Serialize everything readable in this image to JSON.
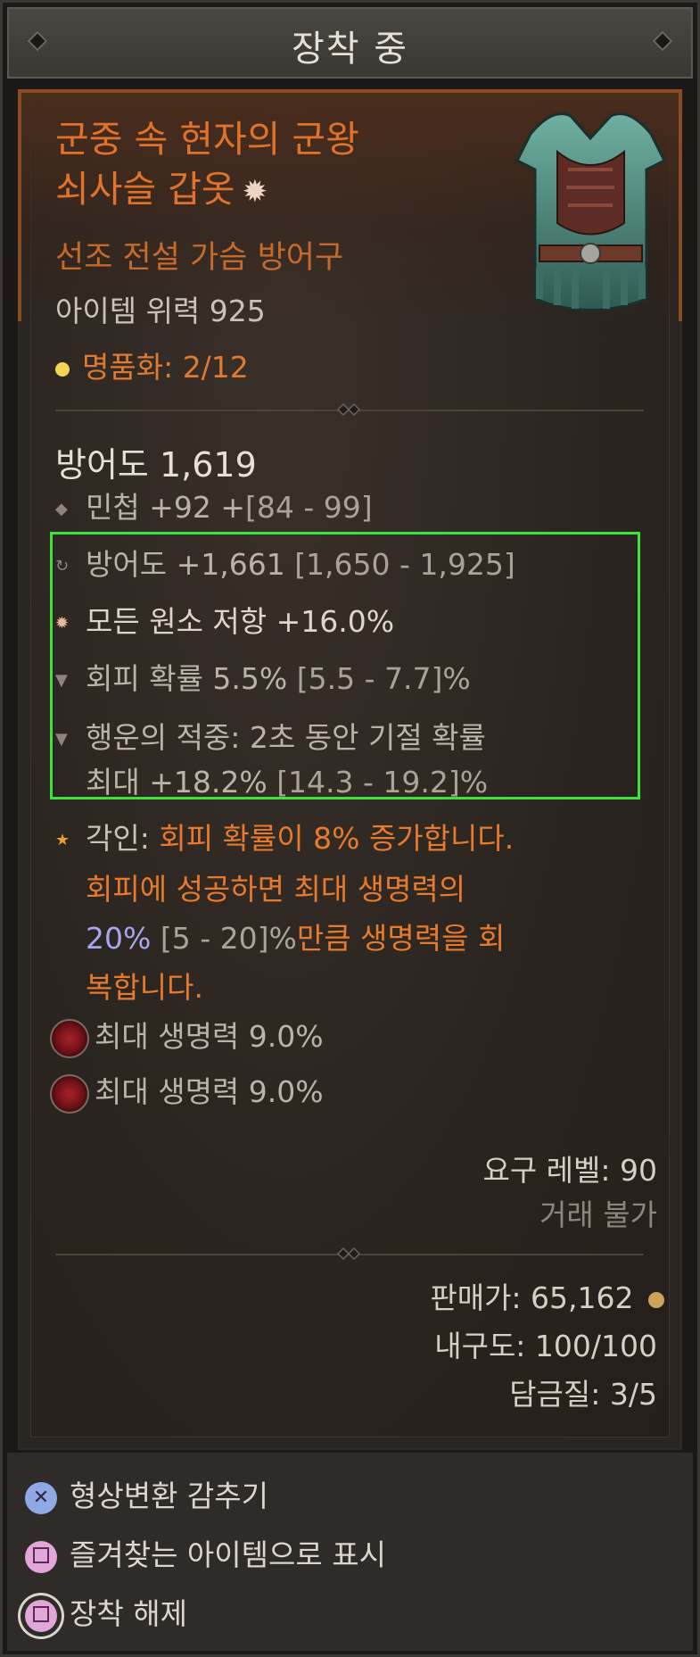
{
  "header": {
    "title": "장착 중"
  },
  "item": {
    "name_line1": "군중 속 현자의 군왕",
    "name_line2": "쇠사슬 갑옷",
    "type": "선조 전설 가슴 방어구",
    "power": "아이템 위력 925",
    "mastery": "명품화: 2/12"
  },
  "base": {
    "armor": "방어도 1,619",
    "implicit": {
      "label": "민첩 +92 +",
      "range": "[84 - 99]"
    }
  },
  "affixes": [
    {
      "label": "방어도 +1,661 ",
      "range": "[1,650 - 1,925]",
      "icon": "circle-arrow-icon"
    },
    {
      "label": "모든 원소 저항 +16.0%",
      "range": "",
      "icon": "snowflake-icon"
    },
    {
      "label": "회피 확률 5.5% ",
      "range": "[5.5 - 7.7]%",
      "icon": "anvil-icon"
    },
    {
      "label": "행운의 적중: 2초 동안 기절 확률",
      "icon": "anvil-icon"
    },
    {
      "label": "최대 +18.2% ",
      "range": "[14.3 - 19.2]%"
    }
  ],
  "aspect": {
    "prefix": "각인: ",
    "part1": "회피 확률이 8% 증가합니다.",
    "part2": "회피에 성공하면 최대 생명력의",
    "value": "20%",
    "range": " [5 - 20]%",
    "part3": "만큼 생명력을 회",
    "part4": "복합니다."
  },
  "sockets": [
    {
      "label": "최대 생명력 9.0%",
      "icon": "ruby-gem-icon"
    },
    {
      "label": "최대 생명력 9.0%",
      "icon": "ruby-gem-icon"
    }
  ],
  "requirements": {
    "level": "요구 레벨: 90",
    "trade": "거래 불가"
  },
  "footer": {
    "sell": "판매가: 65,162",
    "durability": "내구도: 100/100",
    "tempering": "담금질: 3/5"
  },
  "actions": [
    {
      "label": "형상변환 감추기",
      "button": "cross-button-icon"
    },
    {
      "label": "즐겨찾는 아이템으로 표시",
      "button": "square-button-icon"
    },
    {
      "label": "장착 해제",
      "button": "square-button-icon"
    }
  ],
  "colors": {
    "legendary_orange": "#e0722a",
    "highlight_green": "#3fe23a",
    "aspect_blue": "#a9a6ee"
  }
}
